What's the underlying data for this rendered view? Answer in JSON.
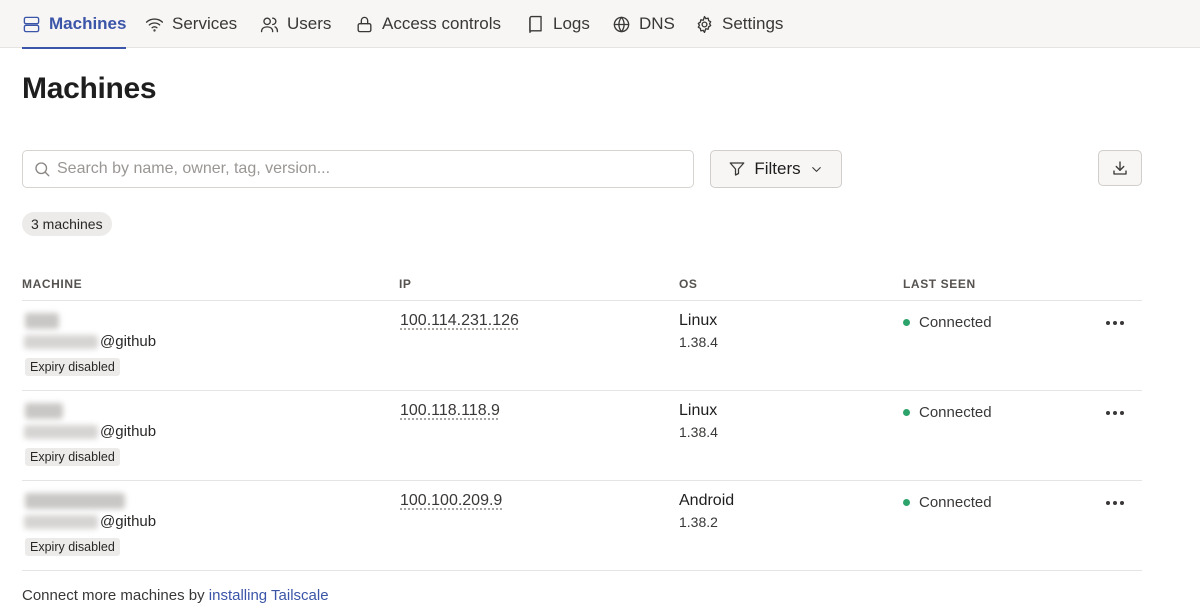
{
  "nav": {
    "items": [
      {
        "label": "Machines",
        "icon": "server-icon",
        "active": true
      },
      {
        "label": "Services",
        "icon": "wifi-icon"
      },
      {
        "label": "Users",
        "icon": "users-icon"
      },
      {
        "label": "Access controls",
        "icon": "lock-icon"
      },
      {
        "label": "Logs",
        "icon": "book-icon"
      },
      {
        "label": "DNS",
        "icon": "globe-icon"
      },
      {
        "label": "Settings",
        "icon": "gear-icon"
      }
    ]
  },
  "page": {
    "title": "Machines"
  },
  "search": {
    "placeholder": "Search by name, owner, tag, version..."
  },
  "filters": {
    "label": "Filters"
  },
  "summary": {
    "count_label": "3 machines"
  },
  "table": {
    "headers": {
      "machine": "MACHINE",
      "ip": "IP",
      "os": "OS",
      "last_seen": "LAST SEEN"
    },
    "rows": [
      {
        "owner_domain": "@github",
        "badge": "Expiry disabled",
        "ip": "100.114.231.126",
        "os": "Linux",
        "version": "1.38.4",
        "status": "Connected"
      },
      {
        "owner_domain": "@github",
        "badge": "Expiry disabled",
        "ip": "100.118.118.9",
        "os": "Linux",
        "version": "1.38.4",
        "status": "Connected"
      },
      {
        "owner_domain": "@github",
        "badge": "Expiry disabled",
        "ip": "100.100.209.9",
        "os": "Android",
        "version": "1.38.2",
        "status": "Connected"
      }
    ]
  },
  "footer": {
    "text": "Connect more machines by ",
    "link": "installing Tailscale"
  },
  "colors": {
    "accent": "#3b55a8",
    "connected": "#2ba36a"
  }
}
